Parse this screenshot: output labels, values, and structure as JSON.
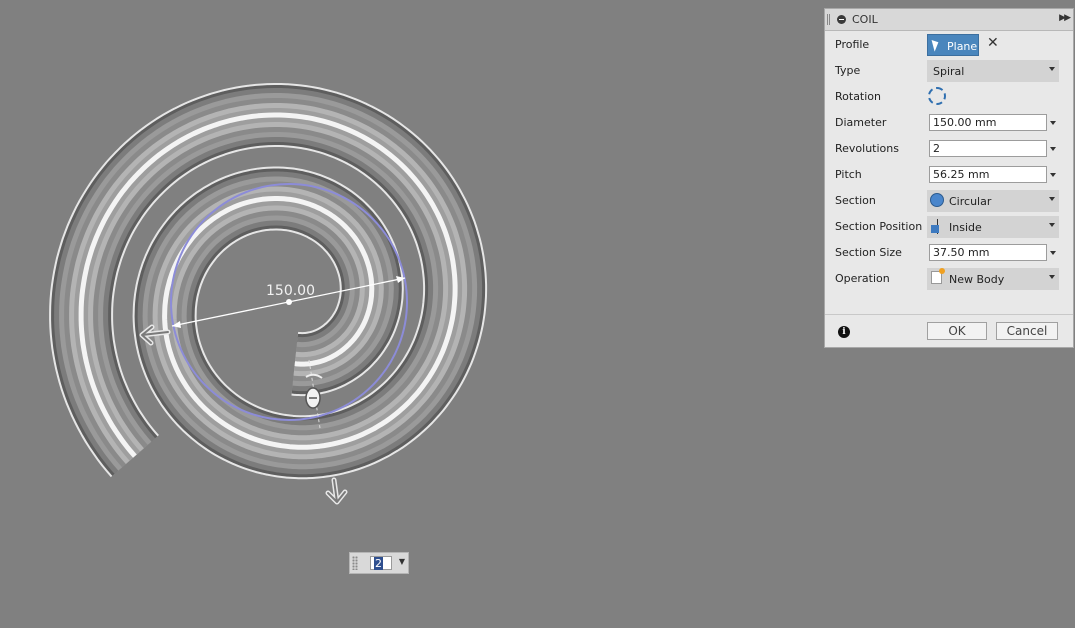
{
  "canvas": {
    "diameter_label": "150.00",
    "revolutions_mini_value": "2"
  },
  "dialog": {
    "title": "COIL",
    "expand_glyph": "▶▶",
    "rows": {
      "profile": {
        "label": "Profile",
        "button": "Plane",
        "clear": "✕"
      },
      "type": {
        "label": "Type",
        "value": "Spiral"
      },
      "rotation": {
        "label": "Rotation",
        "icon": "rotation-direction-icon"
      },
      "diameter": {
        "label": "Diameter",
        "value": "150.00 mm"
      },
      "revolutions": {
        "label": "Revolutions",
        "value": "2"
      },
      "pitch": {
        "label": "Pitch",
        "value": "56.25 mm"
      },
      "section": {
        "label": "Section",
        "value": "Circular",
        "icon": "circle-section-icon"
      },
      "section_position": {
        "label": "Section Position",
        "value": "Inside",
        "icon": "section-position-icon"
      },
      "section_size": {
        "label": "Section Size",
        "value": "37.50 mm"
      },
      "operation": {
        "label": "Operation",
        "value": "New Body",
        "icon": "new-body-icon"
      }
    },
    "footer": {
      "info": "i",
      "ok": "OK",
      "cancel": "Cancel"
    }
  },
  "colors": {
    "background": "#808080",
    "selection_blue": "#4a86bd",
    "sketch_circle": "#8c8cd8"
  }
}
